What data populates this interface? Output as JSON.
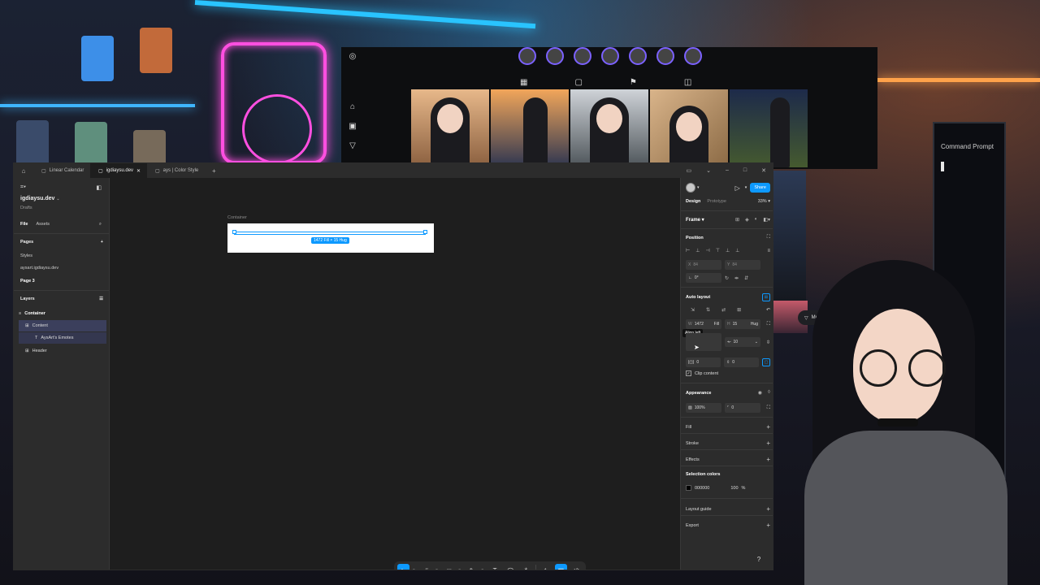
{
  "titlebar": {
    "tabs": [
      {
        "label": "Linear Calendar",
        "active": false
      },
      {
        "label": "igdiaysu.dev",
        "active": true
      },
      {
        "label": "ays | Color Style",
        "active": false
      }
    ],
    "add_tab": "+"
  },
  "left_panel": {
    "project_name": "igdiaysu.dev",
    "project_sub": "Drafts",
    "tab_file": "File",
    "tab_assets": "Assets",
    "pages_heading": "Pages",
    "pages": [
      "Styles",
      "aysart.igdiaysu.dev",
      "Page 3"
    ],
    "layers_heading": "Layers",
    "layers": [
      "Container",
      "Content",
      "AysArt's Emotes",
      "Header"
    ]
  },
  "canvas": {
    "frame_label": "Container",
    "size_label": "1472 Fill × 15 Hug"
  },
  "right_panel": {
    "share_label": "Share",
    "tab_design": "Design",
    "tab_prototype": "Prototype",
    "zoom": "33%",
    "frame_label": "Frame",
    "position_heading": "Position",
    "x_label": "X",
    "x_value": "84",
    "y_label": "Y",
    "y_value": "84",
    "rotation": "0°",
    "auto_layout_heading": "Auto layout",
    "w_label": "W",
    "w_value": "1472",
    "w_mode": "Fill",
    "h_label": "H",
    "h_value": "15",
    "h_mode": "Hug",
    "tooltip": "Align left",
    "gap_value": "10",
    "pad_h": "0",
    "pad_v": "0",
    "clip_content": "Clip content",
    "appearance_heading": "Appearance",
    "opacity": "100%",
    "radius": "0",
    "fill_heading": "Fill",
    "stroke_heading": "Stroke",
    "effects_heading": "Effects",
    "selection_colors_heading": "Selection colors",
    "sel_color_hex": "000000",
    "sel_color_opacity": "100",
    "sel_color_pct": "%",
    "layout_guide_heading": "Layout guide",
    "export_heading": "Export"
  },
  "toolbar": {
    "help": "?"
  },
  "background": {
    "terminal_title": "Command Prompt",
    "messages_label": "Messages"
  },
  "colors": {
    "accent": "#0d99ff",
    "panel": "#2c2c2c",
    "canvas": "#1e1e1e"
  }
}
